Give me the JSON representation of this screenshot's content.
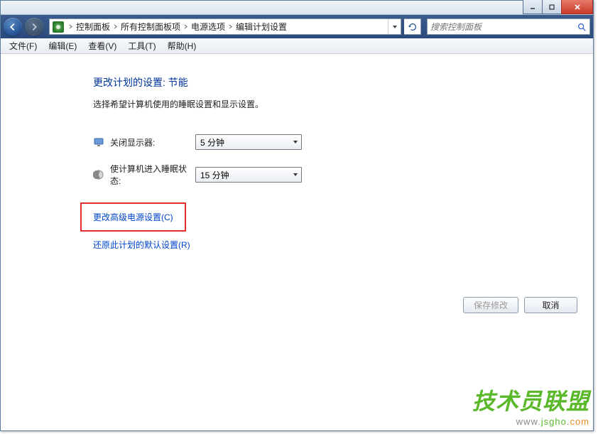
{
  "breadcrumbs": [
    "控制面板",
    "所有控制面板项",
    "电源选项",
    "编辑计划设置"
  ],
  "search": {
    "placeholder": "搜索控制面板"
  },
  "menubar": [
    "文件(F)",
    "编辑(E)",
    "查看(V)",
    "工具(T)",
    "帮助(H)"
  ],
  "page": {
    "title": "更改计划的设置: 节能",
    "desc": "选择希望计算机使用的睡眠设置和显示设置。"
  },
  "settings": {
    "display": {
      "label": "关闭显示器:",
      "value": "5 分钟"
    },
    "sleep": {
      "label": "使计算机进入睡眠状态:",
      "value": "15 分钟"
    }
  },
  "links": {
    "advanced": "更改高级电源设置(C)",
    "restore": "还原此计划的默认设置(R)"
  },
  "buttons": {
    "save": "保存修改",
    "cancel": "取消"
  },
  "watermark": {
    "main": "技术员联盟",
    "sub_prefix": "www.",
    "sub_g": "jsgho",
    "sub_dot": ".",
    "sub_o": "com"
  }
}
